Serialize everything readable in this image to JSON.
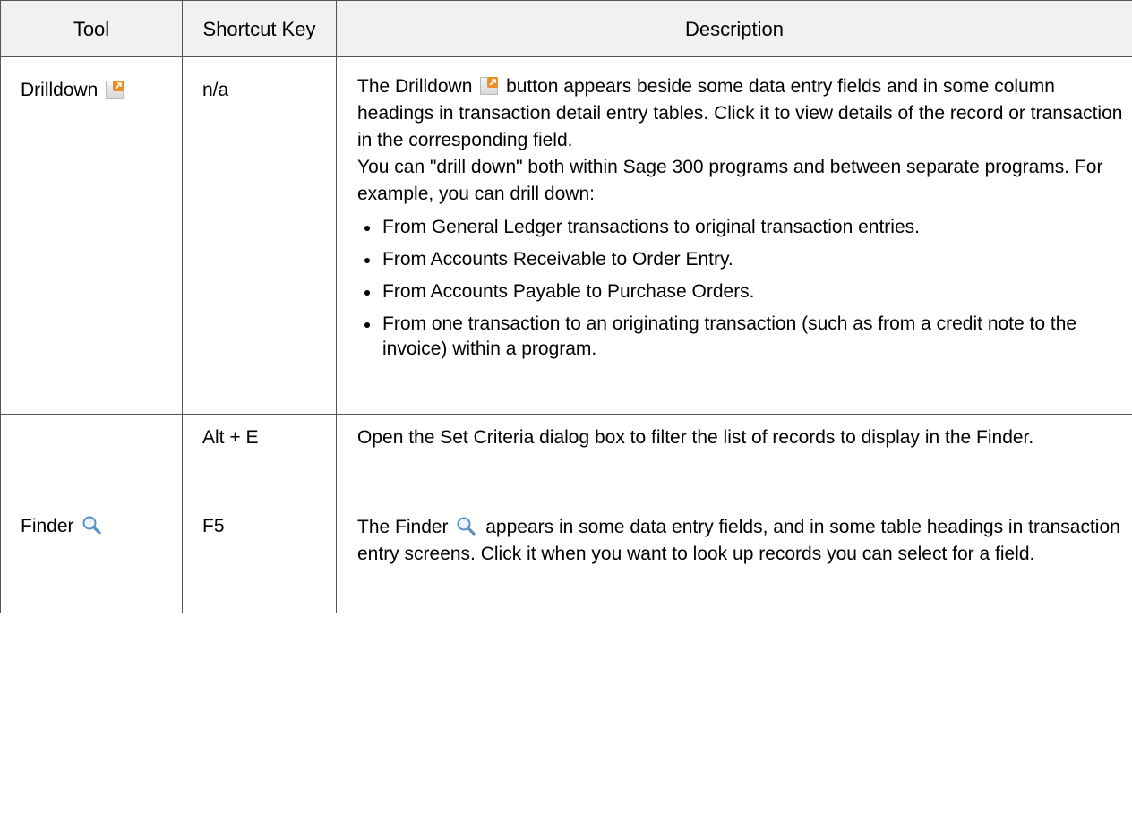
{
  "headers": {
    "tool": "Tool",
    "shortcut": "Shortcut Key",
    "description": "Description"
  },
  "rows": {
    "drilldown": {
      "tool": "Drilldown",
      "icon": "drilldown-icon",
      "shortcut": "n/a",
      "desc_pre": "The Drilldown",
      "desc_post": "button appears beside some data entry fields and in some column headings in transaction detail entry tables. Click it to view details of the record or transaction in the corresponding field.",
      "desc2": "You can \"drill down\" both within Sage 300 programs and between separate programs. For example, you can drill down:",
      "bullets": [
        "From General Ledger transactions to original transaction entries.",
        "From Accounts Receivable to Order Entry.",
        "From Accounts Payable to Purchase Orders.",
        "From one transaction to an originating transaction (such as from a credit note to the invoice) within a program."
      ]
    },
    "criteria": {
      "tool": "",
      "shortcut": "Alt + E",
      "desc": "Open the Set Criteria dialog box to filter the list of records to display in the Finder."
    },
    "finder": {
      "tool": "Finder",
      "icon": "magnifier-icon",
      "shortcut": "F5",
      "desc_pre": "The Finder",
      "desc_post": "appears in some data entry fields, and in some table headings in transaction entry screens. Click it when you want to look up records you can select for a field."
    }
  },
  "colors": {
    "header_bg": "#f1f1f1",
    "border": "#555555",
    "drilldown_accent": "#f28c1e",
    "finder_icon": "#5b8fc4"
  }
}
